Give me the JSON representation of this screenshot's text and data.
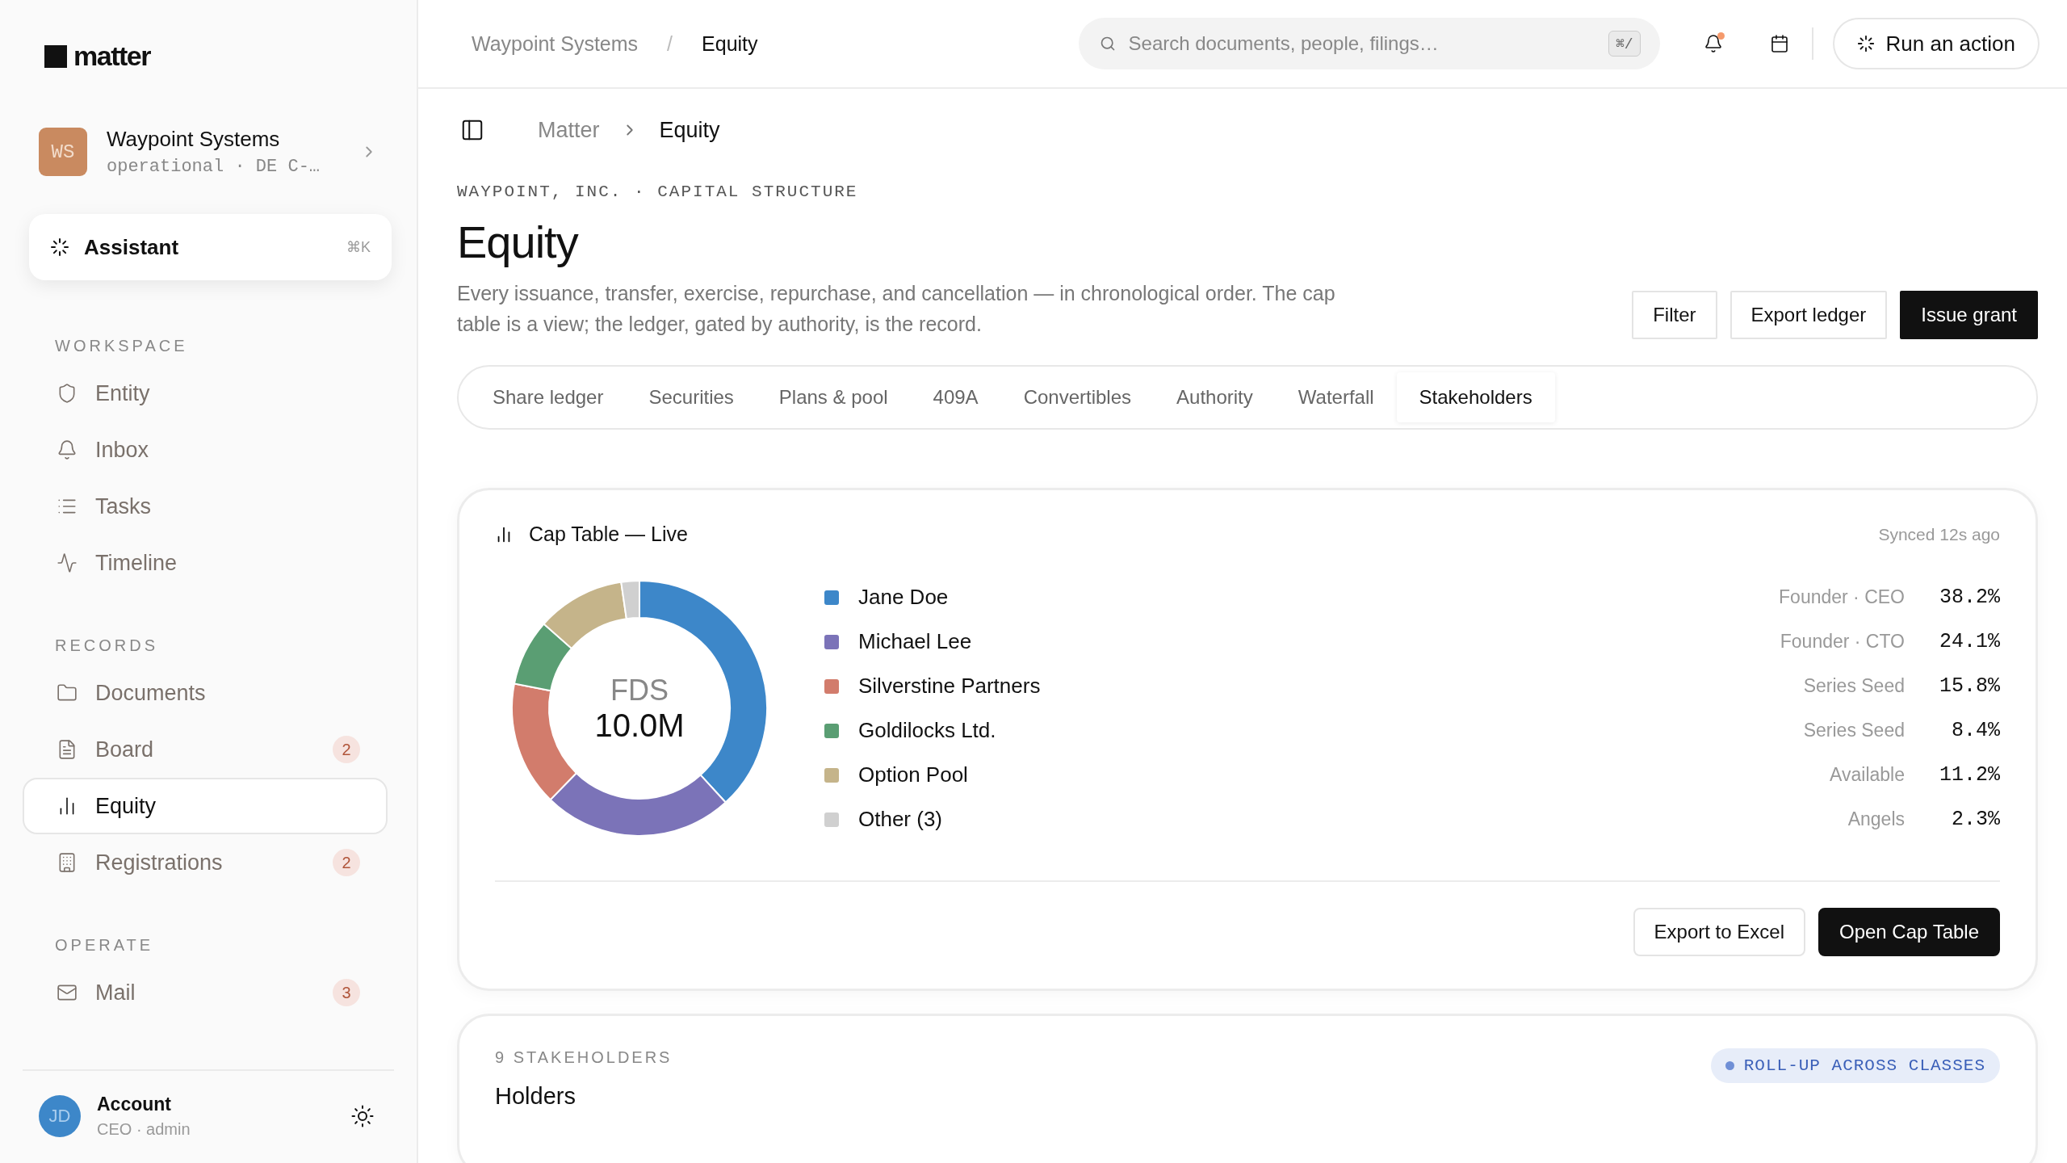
{
  "sidebar": {
    "logo": "matter",
    "workspace": {
      "initials": "WS",
      "name": "Waypoint Systems",
      "meta": "operational · DE C-…"
    },
    "assistant": {
      "label": "Assistant",
      "shortcut": "⌘K"
    },
    "sections": [
      {
        "title": "WORKSPACE",
        "items": [
          {
            "label": "Entity",
            "selected": false
          },
          {
            "label": "Inbox",
            "selected": false
          },
          {
            "label": "Tasks",
            "selected": false
          },
          {
            "label": "Timeline",
            "selected": false
          }
        ]
      },
      {
        "title": "RECORDS",
        "items": [
          {
            "label": "Documents",
            "selected": false
          },
          {
            "label": "Board",
            "selected": false,
            "badge": "2"
          },
          {
            "label": "Equity",
            "selected": true
          },
          {
            "label": "Registrations",
            "selected": false,
            "badge": "2"
          }
        ]
      },
      {
        "title": "OPERATE",
        "items": [
          {
            "label": "Mail",
            "selected": false,
            "badge": "3"
          }
        ]
      }
    ],
    "account": {
      "initials": "JD",
      "name": "Account",
      "role": "CEO · admin"
    }
  },
  "topbar": {
    "crumbs": [
      "Waypoint Systems",
      "Equity"
    ],
    "separator": "/",
    "search": {
      "placeholder": "Search documents, people, filings…",
      "shortcut": "⌘/"
    },
    "notification": true,
    "action": "Run an action"
  },
  "breadcrumb": {
    "items": [
      "Matter",
      "Equity"
    ]
  },
  "header": {
    "eyebrow": "WAYPOINT, INC. · CAPITAL STRUCTURE",
    "title": "Equity",
    "description": "Every issuance, transfer, exercise, repurchase, and cancellation — in chronological order. The cap table is a view; the ledger, gated by authority, is the record.",
    "buttons": [
      {
        "label": "Filter",
        "primary": false
      },
      {
        "label": "Export ledger",
        "primary": false
      },
      {
        "label": "Issue grant",
        "primary": true
      }
    ]
  },
  "tabs": [
    {
      "label": "Share ledger",
      "selected": false
    },
    {
      "label": "Securities",
      "selected": false
    },
    {
      "label": "Plans & pool",
      "selected": false
    },
    {
      "label": "409A",
      "selected": false
    },
    {
      "label": "Convertibles",
      "selected": false
    },
    {
      "label": "Authority",
      "selected": false
    },
    {
      "label": "Waterfall",
      "selected": false
    },
    {
      "label": "Stakeholders",
      "selected": true
    }
  ],
  "cap_table": {
    "title": "Cap Table — Live",
    "synced": "Synced 12s ago",
    "center_label": "FDS",
    "center_value": "10.0M",
    "holders": [
      {
        "role": "Founder · CEO",
        "percent": "38.2%",
        "color": "#3d87c9"
      },
      {
        "role": "Founder · CTO",
        "percent": "24.1%",
        "color": "#7b73b8"
      },
      {
        "role": "Series Seed",
        "percent": "15.8%",
        "color": "#d27c6c"
      },
      {
        "role": "Series Seed",
        "percent": "8.4%",
        "color": "#5a9e73"
      },
      {
        "role": "Available",
        "percent": "11.2%",
        "color": "#c5b48a"
      },
      {
        "role": "Angels",
        "percent": "2.3%",
        "color": "#d0d0d0"
      }
    ],
    "chart_data": {
      "type": "donut",
      "categories": [
        "Jane Doe",
        "Michael Lee",
        "Silverstine Partners",
        "Goldilocks Ltd.",
        "Option Pool",
        "Other (3)"
      ],
      "values": [
        38.2,
        24.1,
        15.8,
        8.4,
        11.2,
        2.3
      ]
    },
    "buttons": [
      {
        "label": "Export to Excel",
        "primary": false
      },
      {
        "label": "Open Cap Table",
        "primary": true
      }
    ]
  },
  "holders_card": {
    "eyebrow": "9 STAKEHOLDERS",
    "title": "Holders",
    "tag": "ROLL-UP ACROSS CLASSES"
  }
}
